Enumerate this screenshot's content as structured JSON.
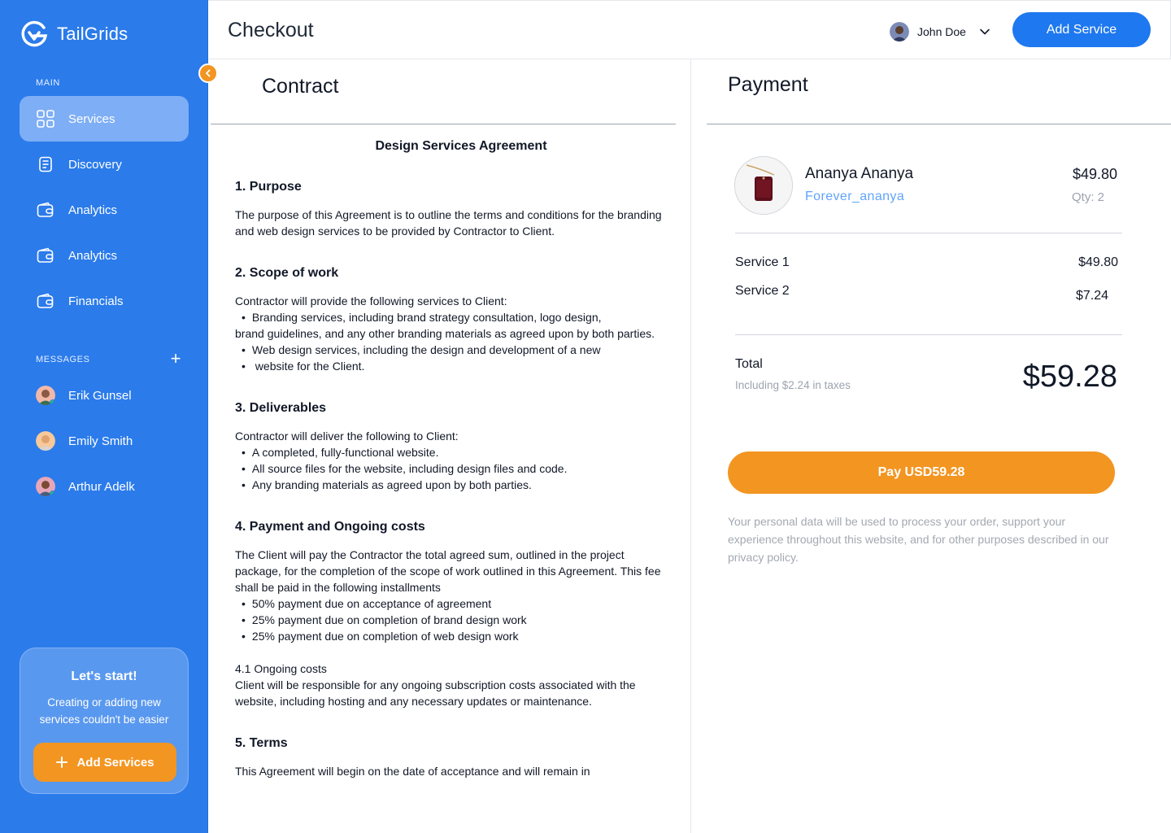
{
  "brand": {
    "name": "TailGrids"
  },
  "sidebar": {
    "main_label": "MAIN",
    "items": [
      {
        "label": "Services",
        "icon": "grid-icon",
        "active": true
      },
      {
        "label": "Discovery",
        "icon": "document-icon"
      },
      {
        "label": "Analytics",
        "icon": "wallet-icon"
      },
      {
        "label": "Analytics",
        "icon": "wallet-icon"
      },
      {
        "label": "Financials",
        "icon": "wallet-icon"
      }
    ],
    "messages_label": "MESSAGES",
    "messages": [
      {
        "name": "Erik Gunsel"
      },
      {
        "name": "Emily Smith"
      },
      {
        "name": "Arthur Adelk"
      }
    ],
    "promo": {
      "title": "Let's start!",
      "text": "Creating or adding new services couldn't be easier",
      "button": "Add Services"
    }
  },
  "header": {
    "title": "Checkout",
    "user": "John Doe",
    "add_button": "Add Service"
  },
  "contract": {
    "title": "Contract",
    "doc_title": "Design Services Agreement",
    "s1_heading": "1. Purpose",
    "s1_text": "The purpose of this Agreement is to outline the terms and conditions for the branding and web design services to be provided by Contractor to Client.",
    "s2_heading": "2. Scope of work",
    "s2_intro": "Contractor will provide the following services to Client:",
    "s2_b1": "Branding services, including brand strategy consultation, logo design,",
    "s2_b1_cont": "brand guidelines, and any other branding materials as agreed upon by both parties.",
    "s2_b2": "Web design services, including the design and development of a new",
    "s2_b3": " website for the Client.",
    "s3_heading": "3. Deliverables",
    "s3_intro": "Contractor will deliver the following to Client:",
    "s3_b1": "A completed, fully-functional website.",
    "s3_b2": "All source files for the website, including design files and code.",
    "s3_b3": "Any branding materials as agreed upon by both parties.",
    "s4_heading": "4. Payment and Ongoing costs",
    "s4_text": "The Client will pay the Contractor the total agreed sum, outlined in the project package, for the completion of the scope of work outlined in this Agreement. This fee shall be paid in the following installments",
    "s4_b1": "50% payment due on acceptance of agreement",
    "s4_b2": "25% payment due on completion of brand design work",
    "s4_b3": "25% payment due on completion of web design work",
    "s41_title": "4.1 Ongoing costs",
    "s41_text": "Client will be responsible for any ongoing subscription costs associated with the website, including hosting and any necessary updates or maintenance.",
    "s5_heading": "5. Terms",
    "s5_text": "This Agreement will begin on the date of acceptance and will remain in"
  },
  "payment": {
    "title": "Payment",
    "product": {
      "name": "Ananya Ananya",
      "user": "Forever_ananya",
      "price": "$49.80",
      "qty": "Qty: 2"
    },
    "lines": [
      {
        "label": "Service 1",
        "value": "$49.80"
      },
      {
        "label": "Service 2",
        "value": "$7.24"
      }
    ],
    "total_label": "Total",
    "total_note": "Including $2.24 in taxes",
    "total_amount": "$59.28",
    "pay_button": "Pay USD59.28",
    "privacy": "Your personal data will be used to process your order, support your experience throughout this website, and for other purposes described in our privacy policy."
  },
  "colors": {
    "sidebar": "#2B7BEB",
    "accent_orange": "#F39521",
    "primary_blue": "#1E78EF"
  }
}
